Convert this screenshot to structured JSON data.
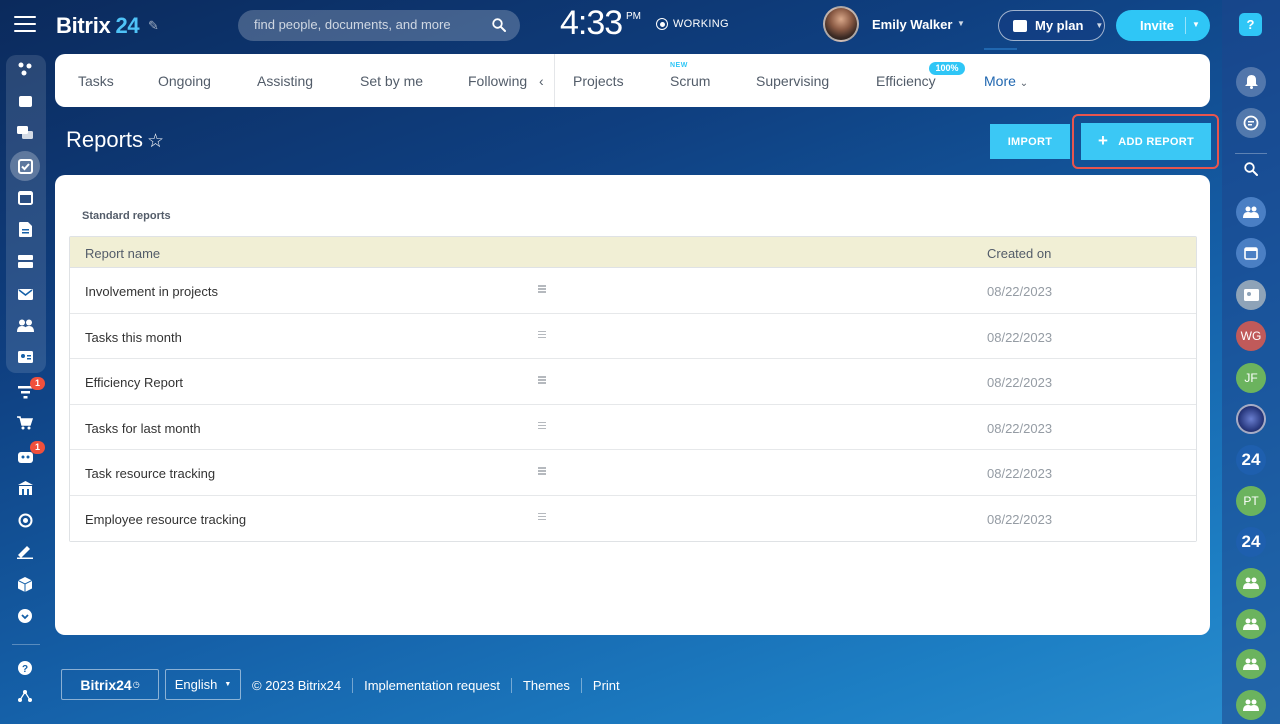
{
  "header": {
    "logo_text": "Bitrix",
    "logo_num": "24",
    "search_placeholder": "find people, documents, and more",
    "clock": "4:33",
    "ampm": "PM",
    "work_status": "WORKING",
    "user_name": "Emily Walker",
    "plan_label": "My plan",
    "invite_label": "Invite"
  },
  "tabs": [
    {
      "label": "Tasks"
    },
    {
      "label": "Ongoing"
    },
    {
      "label": "Assisting"
    },
    {
      "label": "Set by me"
    },
    {
      "label": "Following"
    },
    {
      "label": "Projects"
    },
    {
      "label": "Scrum",
      "badge": "NEW"
    },
    {
      "label": "Supervising"
    },
    {
      "label": "Efficiency",
      "badge": "100%"
    },
    {
      "label": "More"
    }
  ],
  "page": {
    "title": "Reports",
    "import_label": "IMPORT",
    "add_report_label": "ADD REPORT"
  },
  "reports": {
    "section_title": "Standard reports",
    "col_name": "Report name",
    "col_created": "Created on",
    "rows": [
      {
        "name": "Involvement in projects",
        "created": "08/22/2023"
      },
      {
        "name": "Tasks this month",
        "created": "08/22/2023"
      },
      {
        "name": "Efficiency Report",
        "created": "08/22/2023"
      },
      {
        "name": "Tasks for last month",
        "created": "08/22/2023"
      },
      {
        "name": "Task resource tracking",
        "created": "08/22/2023"
      },
      {
        "name": "Employee resource tracking",
        "created": "08/22/2023"
      }
    ]
  },
  "footer": {
    "logo": "Bitrix24",
    "language": "English",
    "copyright": "© 2023 Bitrix24",
    "impl_request": "Implementation request",
    "themes": "Themes",
    "print": "Print"
  },
  "left_badges": [
    "1",
    "1"
  ],
  "right_avatars": [
    "WG",
    "JF",
    "24",
    "PT",
    "24"
  ],
  "colors": {
    "accent": "#2fc6f6",
    "highlight_border": "#e8554e",
    "active_tab": "#2067b0",
    "table_header_bg": "#f1efd5"
  }
}
